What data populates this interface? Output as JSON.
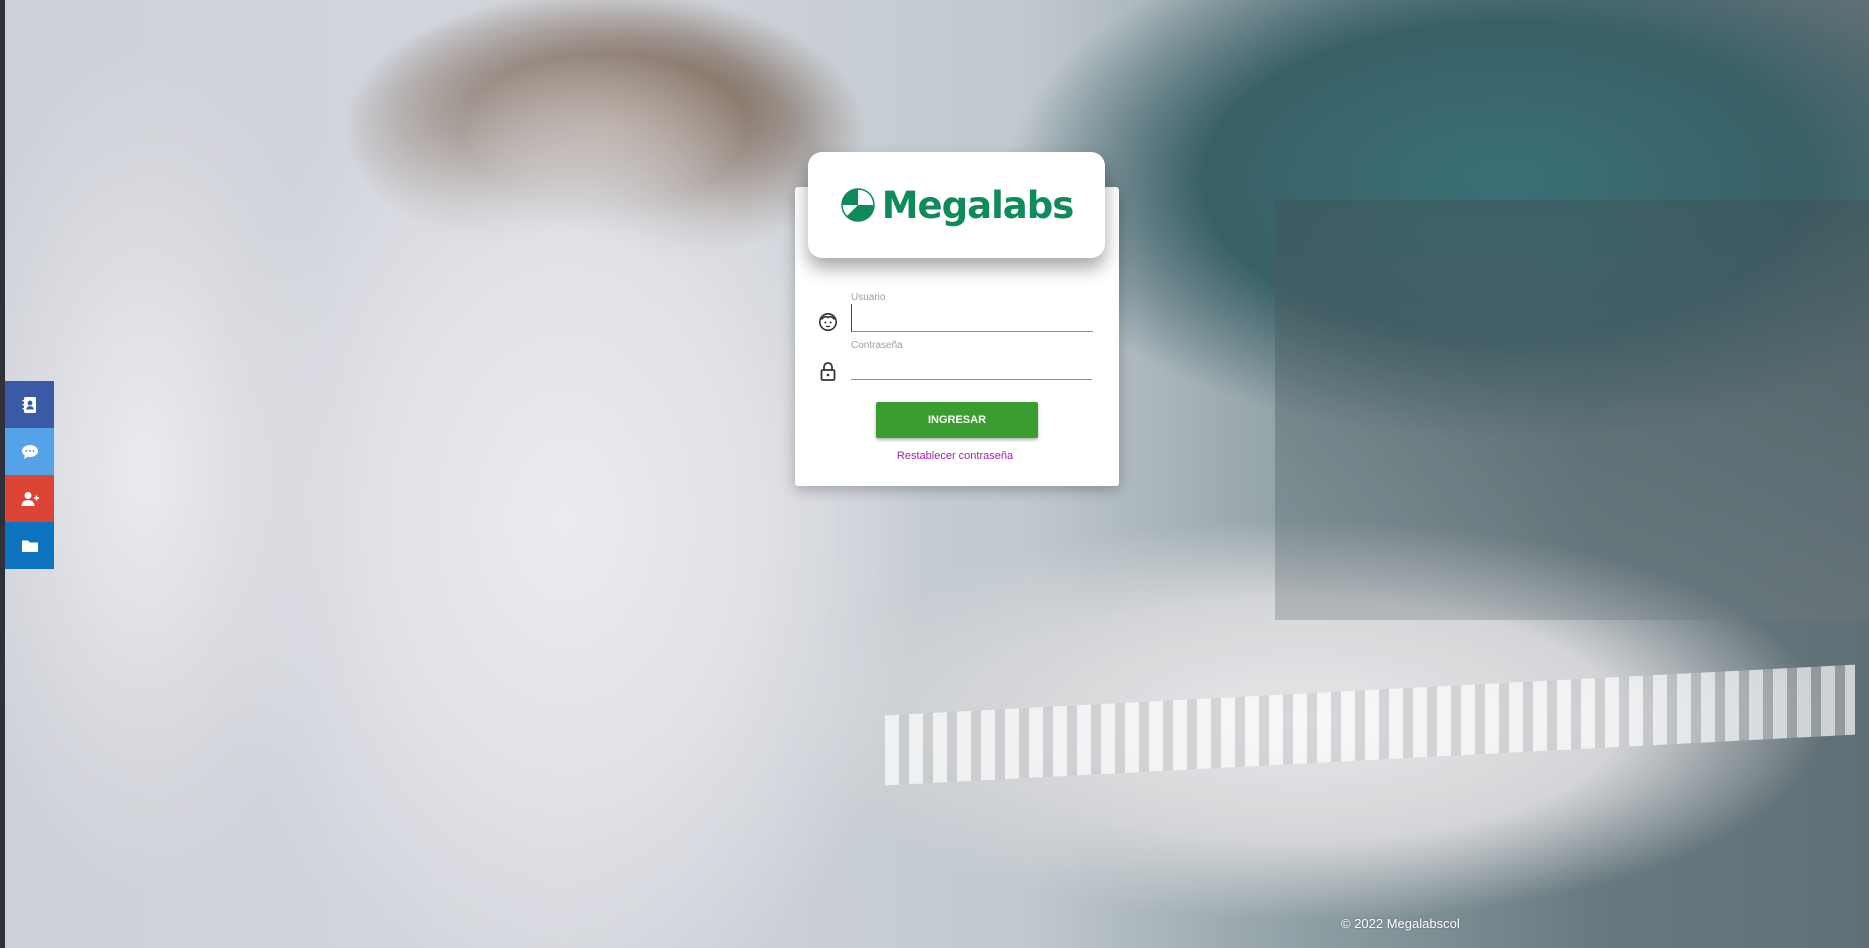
{
  "brand": {
    "name": "Megalabs",
    "color": "#0f8a5a"
  },
  "login": {
    "user_label": "Usuario",
    "user_value": "",
    "password_label": "Contraseña",
    "password_value": "",
    "submit_label": "INGRESAR",
    "reset_label": "Restablecer contraseña"
  },
  "sidebar": {
    "items": [
      {
        "icon": "contact-book-icon",
        "color": "#3b5aa5"
      },
      {
        "icon": "chat-icon",
        "color": "#54a2e8"
      },
      {
        "icon": "user-plus-icon",
        "color": "#dc4436"
      },
      {
        "icon": "folder-icon",
        "color": "#0e73bf"
      }
    ]
  },
  "colors": {
    "submit": "#3b9c2f",
    "link": "#9c27b0"
  },
  "footer": {
    "copyright": "© 2022 Megalabscol"
  }
}
